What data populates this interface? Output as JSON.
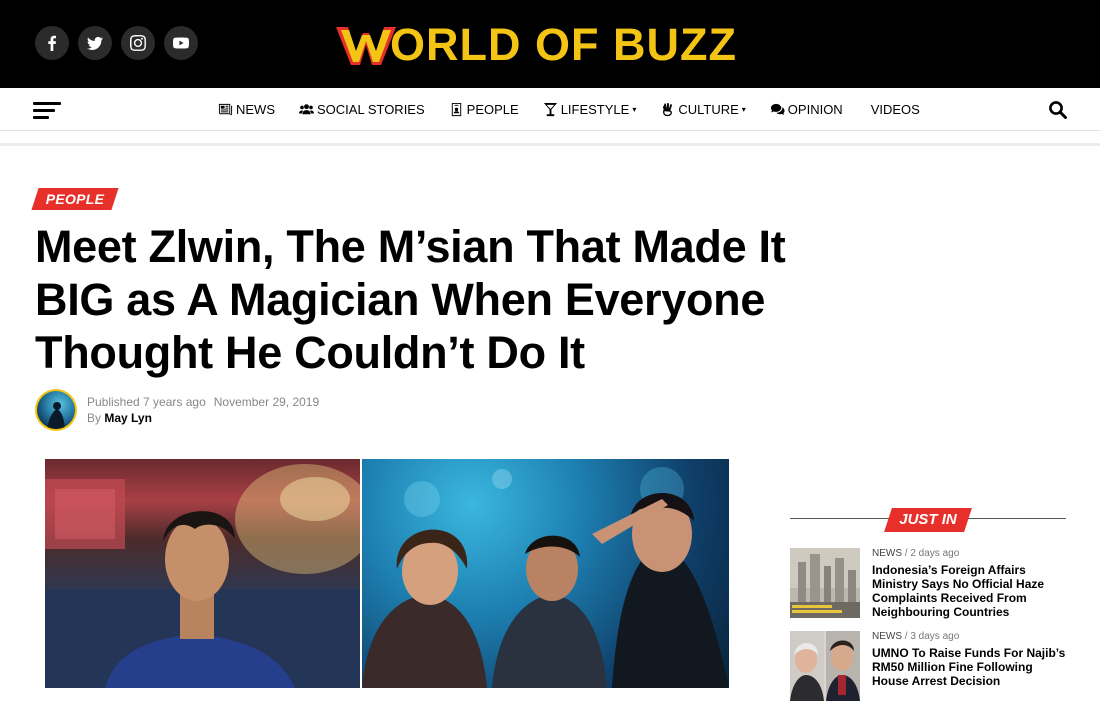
{
  "social": {
    "icons": [
      "facebook-icon",
      "twitter-icon",
      "instagram-icon",
      "youtube-icon"
    ]
  },
  "logo": {
    "text": "ORLD OF BUZZ",
    "letter": "W",
    "colors": {
      "gold": "#f4c414",
      "red": "#e8302a"
    }
  },
  "nav": {
    "items": [
      {
        "label": "NEWS",
        "icon": "newspaper-icon",
        "dropdown": false
      },
      {
        "label": "SOCIAL STORIES",
        "icon": "users-icon",
        "dropdown": false
      },
      {
        "label": "PEOPLE",
        "icon": "id-badge-icon",
        "dropdown": false
      },
      {
        "label": "LIFESTYLE",
        "icon": "cocktail-icon",
        "dropdown": true
      },
      {
        "label": "CULTURE",
        "icon": "peace-hand-icon",
        "dropdown": true
      },
      {
        "label": "OPINION",
        "icon": "comments-icon",
        "dropdown": false
      },
      {
        "label": "VIDEOS",
        "icon": "",
        "dropdown": false
      }
    ]
  },
  "article": {
    "category": "PEOPLE",
    "title": "Meet Zlwin, The M’sian That Made It BIG as A Magician When Everyone Thought He Couldn’t Do It",
    "published": "Published 7 years ago",
    "date": "November 29, 2019",
    "by": "By",
    "author": "May Lyn"
  },
  "sidebar": {
    "heading": "JUST IN",
    "items": [
      {
        "category": "NEWS",
        "time": "2 days ago",
        "title": "Indonesia’s Foreign Affairs Ministry Says No Official Haze Complaints Received From Neighbouring Countries"
      },
      {
        "category": "NEWS",
        "time": "3 days ago",
        "title": "UMNO To Raise Funds For Najib’s RM50 Million Fine Following House Arrest Decision"
      }
    ]
  },
  "colors": {
    "accent": "#e8302a",
    "topbar": "#000000"
  }
}
